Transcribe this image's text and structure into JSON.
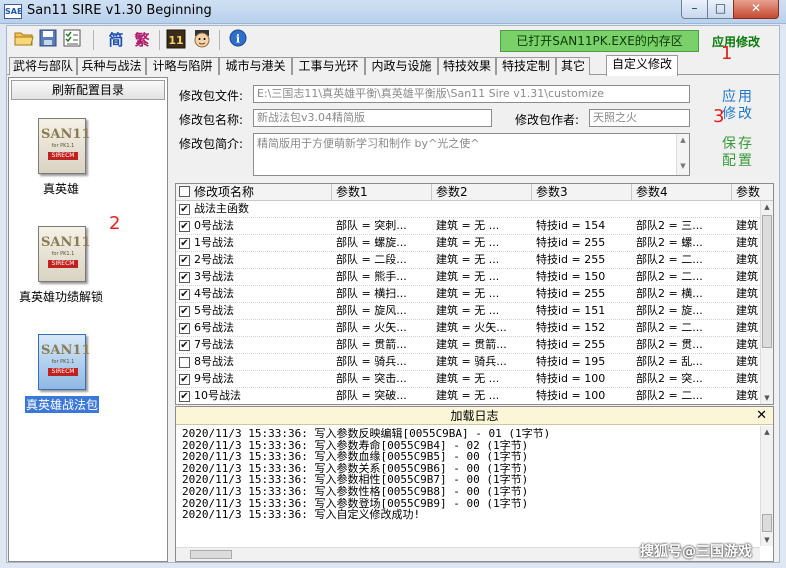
{
  "app": {
    "icon_text": "SAE",
    "title": "San11 SIRE v1.30 Beginning"
  },
  "window_controls": {
    "minimize": "–",
    "maximize": "□",
    "close": "✕"
  },
  "toolbar": {
    "simplified": "简",
    "traditional": "繁",
    "game_icon": "11",
    "info": "i",
    "status": "已打开SAN11PK.EXE的内存区",
    "apply": "应用修改"
  },
  "markers": {
    "m1": "1",
    "m2": "2",
    "m3": "3"
  },
  "tabs": [
    {
      "label": "武将与部队"
    },
    {
      "label": "兵种与战法"
    },
    {
      "label": "计略与陷阱"
    },
    {
      "label": "城市与港关"
    },
    {
      "label": "工事与光环"
    },
    {
      "label": "内政与设施"
    },
    {
      "label": "特技效果"
    },
    {
      "label": "特技定制"
    },
    {
      "label": "其它"
    },
    {
      "label": "自定义修改"
    }
  ],
  "left_panel": {
    "refresh": "刷新配置目录",
    "icon_big": "SAN11",
    "icon_small": "for PK1.1",
    "icon_band": "SIRECM",
    "presets": [
      {
        "label": "真英雄"
      },
      {
        "label": "真英雄功绩解锁"
      },
      {
        "label": "真英雄战法包"
      }
    ]
  },
  "form": {
    "file_label": "修改包文件:",
    "file_value": "E:\\三国志11\\真英雄平衡\\真英雄平衡版\\San11 Sire v1.31\\customize",
    "name_label": "修改包名称:",
    "name_value": "新战法包v3.04精简版",
    "author_label": "修改包作者:",
    "author_value": "天照之火",
    "desc_label": "修改包简介:",
    "desc_value": "精简版用于方便萌新学习和制作 by^光之使^",
    "apply_l1": "应用",
    "apply_l2": "修改",
    "save_l1": "保存",
    "save_l2": "配置"
  },
  "grid": {
    "columns": [
      "修改项名称",
      "参数1",
      "参数2",
      "参数3",
      "参数4",
      "参数"
    ],
    "rows": [
      {
        "checked": true,
        "name": "战法主函数",
        "p1": "",
        "p2": "",
        "p3": "",
        "p4": "",
        "p5": ""
      },
      {
        "checked": true,
        "name": "0号战法",
        "p1": "部队 = 突刺...",
        "p2": "建筑 = 无  ...",
        "p3": "特技id = 154",
        "p4": "部队2 = 三...",
        "p5": "建筑"
      },
      {
        "checked": true,
        "name": "1号战法",
        "p1": "部队 = 螺旋...",
        "p2": "建筑 = 无  ...",
        "p3": "特技id = 255",
        "p4": "部队2 = 螺...",
        "p5": "建筑"
      },
      {
        "checked": true,
        "name": "2号战法",
        "p1": "部队 = 二段...",
        "p2": "建筑 = 无  ...",
        "p3": "特技id = 255",
        "p4": "部队2 = 二...",
        "p5": "建筑"
      },
      {
        "checked": true,
        "name": "3号战法",
        "p1": "部队 = 熊手...",
        "p2": "建筑 = 无  ...",
        "p3": "特技id = 150",
        "p4": "部队2 = 二...",
        "p5": "建筑"
      },
      {
        "checked": true,
        "name": "4号战法",
        "p1": "部队 = 横扫...",
        "p2": "建筑 = 无  ...",
        "p3": "特技id = 255",
        "p4": "部队2 = 横...",
        "p5": "建筑"
      },
      {
        "checked": true,
        "name": "5号战法",
        "p1": "部队 = 旋风...",
        "p2": "建筑 = 无  ...",
        "p3": "特技id = 151",
        "p4": "部队2 = 旋...",
        "p5": "建筑"
      },
      {
        "checked": true,
        "name": "6号战法",
        "p1": "部队 = 火矢...",
        "p2": "建筑 = 火矢...",
        "p3": "特技id = 152",
        "p4": "部队2 = 二...",
        "p5": "建筑"
      },
      {
        "checked": true,
        "name": "7号战法",
        "p1": "部队 = 贯箭...",
        "p2": "建筑 = 贯箭...",
        "p3": "特技id = 255",
        "p4": "部队2 = 贯...",
        "p5": "建筑"
      },
      {
        "checked": false,
        "name": "8号战法",
        "p1": "部队 = 骑兵...",
        "p2": "建筑 = 骑兵...",
        "p3": "特技id = 195",
        "p4": "部队2 = 乱...",
        "p5": "建筑"
      },
      {
        "checked": true,
        "name": "9号战法",
        "p1": "部队 = 突击...",
        "p2": "建筑 = 无  ...",
        "p3": "特技id = 100",
        "p4": "部队2 = 突...",
        "p5": "建筑"
      },
      {
        "checked": true,
        "name": "10号战法",
        "p1": "部队 = 突破...",
        "p2": "建筑 = 无  ...",
        "p3": "特技id = 100",
        "p4": "部队2 = 二...",
        "p5": "建筑"
      }
    ]
  },
  "log": {
    "title": "加载日志",
    "close": "✕",
    "lines": [
      "2020/11/3 15:33:36: 写入参数反映编辑[0055C9BA] - 01 (1字节)",
      "2020/11/3 15:33:36: 写入参数寿命[0055C9B4] - 02 (1字节)",
      "2020/11/3 15:33:36: 写入参数血缘[0055C9B5] - 00 (1字节)",
      "2020/11/3 15:33:36: 写入参数关系[0055C9B6] - 00 (1字节)",
      "2020/11/3 15:33:36: 写入参数相性[0055C9B7] - 00 (1字节)",
      "2020/11/3 15:33:36: 写入参数性格[0055C9B8] - 00 (1字节)",
      "2020/11/3 15:33:36: 写入参数登场[0055C9B9] - 00 (1字节)",
      "2020/11/3 15:33:36: 写入自定义修改成功!"
    ]
  },
  "watermark": "搜狐号@三国游戏"
}
